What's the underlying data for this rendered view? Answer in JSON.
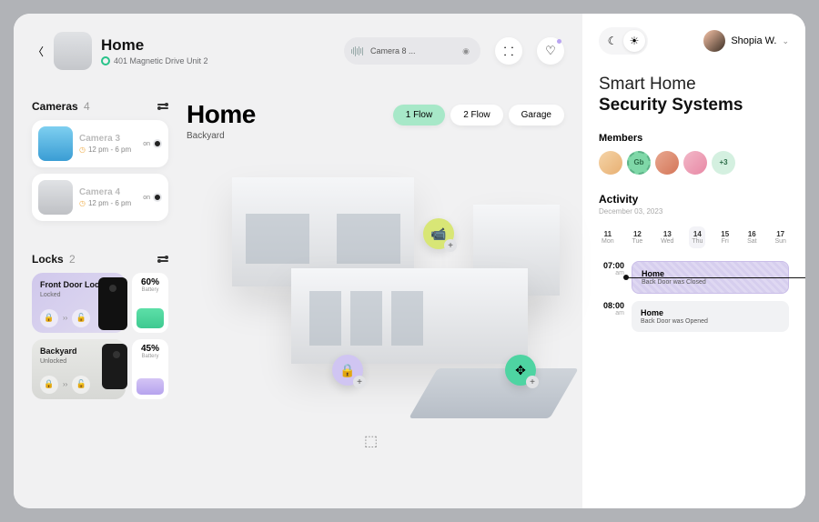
{
  "header": {
    "title": "Home",
    "address": "401 Magnetic Drive Unit 2",
    "search_label": "Camera 8 ..."
  },
  "theme": {
    "user_name": "Shopia W."
  },
  "cameras": {
    "section_label": "Cameras",
    "count": "4",
    "items": [
      {
        "name": "Camera",
        "num": "3",
        "time": "12 pm - 6 pm",
        "toggle": "on"
      },
      {
        "name": "Camera",
        "num": "4",
        "time": "12 pm - 6 pm",
        "toggle": "on"
      }
    ]
  },
  "locks": {
    "section_label": "Locks",
    "count": "2",
    "items": [
      {
        "name": "Front Door Lock",
        "status": "Locked",
        "battery_pct": "60%",
        "battery_label": "Battery"
      },
      {
        "name": "Backyard",
        "status": "Unlocked",
        "battery_pct": "45%",
        "battery_label": "Battery"
      }
    ]
  },
  "main": {
    "title": "Home",
    "subtitle": "Backyard",
    "filters": [
      "1 Flow",
      "2 Flow",
      "Garage"
    ]
  },
  "panel": {
    "title_line1": "Smart Home",
    "title_line2": "Security Systems",
    "members_label": "Members",
    "member_badge": "Gb",
    "extra_count": "+3",
    "activity_label": "Activity",
    "activity_date": "December 03, 2023",
    "days": [
      {
        "n": "11",
        "w": "Mon"
      },
      {
        "n": "12",
        "w": "Tue"
      },
      {
        "n": "13",
        "w": "Wed"
      },
      {
        "n": "14",
        "w": "Thu"
      },
      {
        "n": "15",
        "w": "Fri"
      },
      {
        "n": "16",
        "w": "Sat"
      },
      {
        "n": "17",
        "w": "Sun"
      }
    ],
    "events": [
      {
        "time": "07:00",
        "ampm": "am",
        "name": "Home",
        "text": "Back Door was Closed"
      },
      {
        "time": "08:00",
        "ampm": "am",
        "name": "Home",
        "text": "Back Door was Opened"
      }
    ]
  }
}
